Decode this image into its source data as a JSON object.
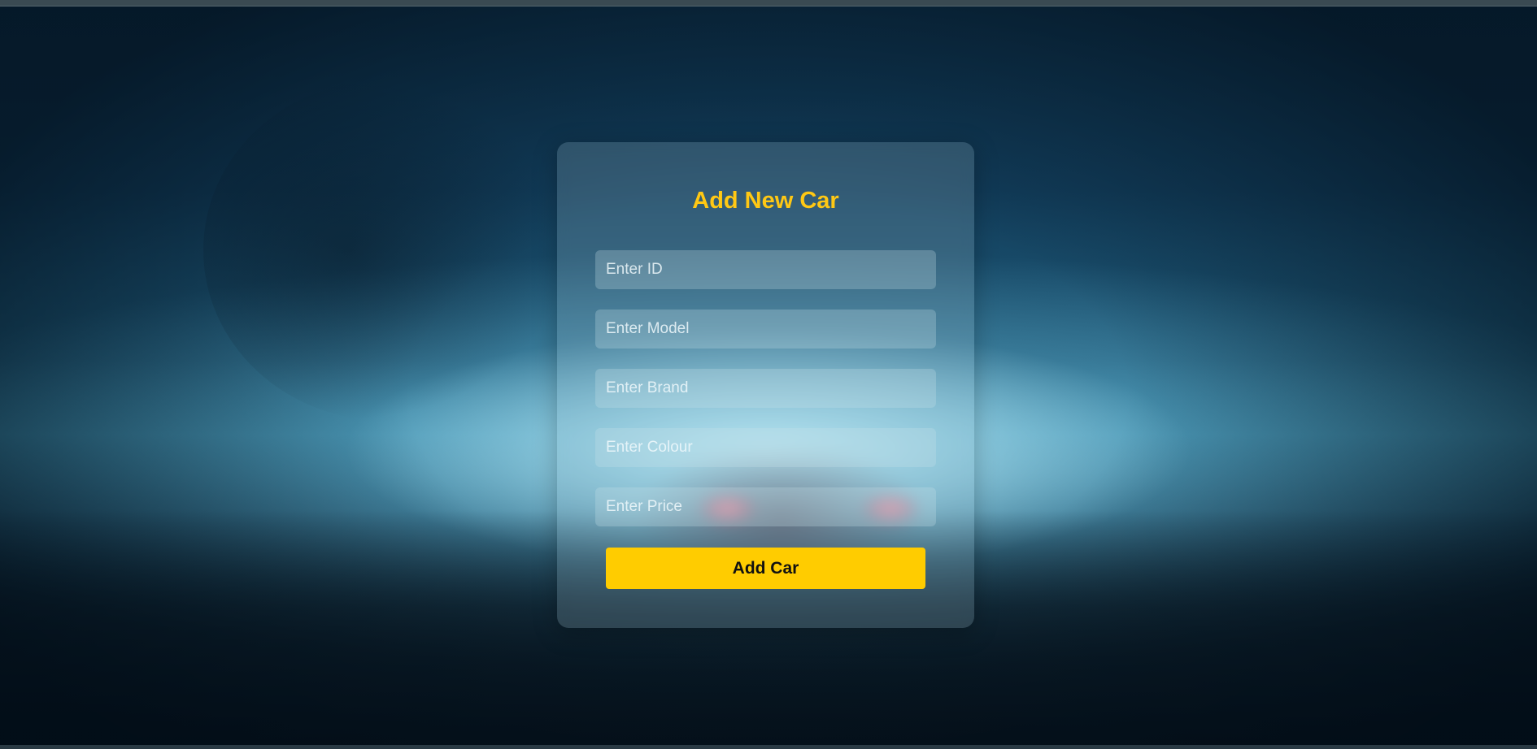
{
  "form": {
    "title": "Add New Car",
    "fields": {
      "id": {
        "placeholder": "Enter ID",
        "value": ""
      },
      "model": {
        "placeholder": "Enter Model",
        "value": ""
      },
      "brand": {
        "placeholder": "Enter Brand",
        "value": ""
      },
      "colour": {
        "placeholder": "Enter Colour",
        "value": ""
      },
      "price": {
        "placeholder": "Enter Price",
        "value": ""
      }
    },
    "submit_label": "Add Car"
  },
  "colors": {
    "accent": "#ffc814",
    "button": "#ffcc00"
  }
}
